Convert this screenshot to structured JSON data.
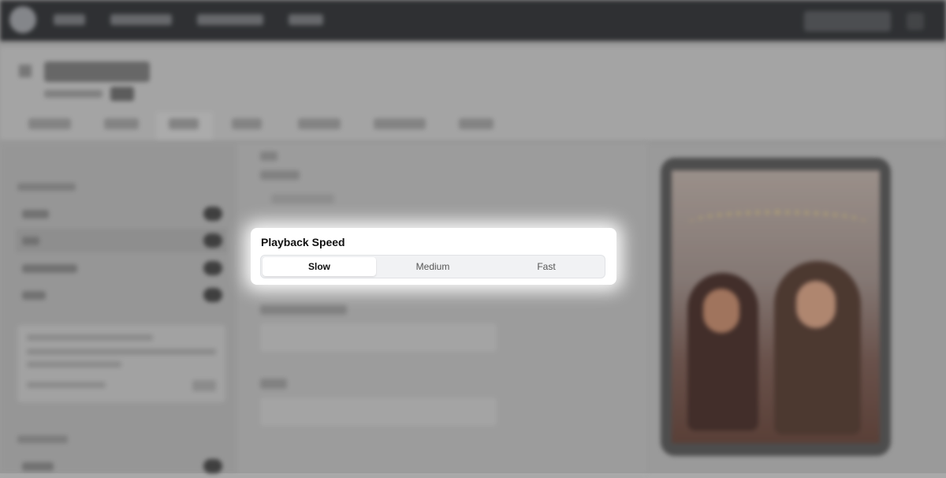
{
  "playback_speed": {
    "title": "Playback Speed",
    "options": [
      "Slow",
      "Medium",
      "Fast"
    ],
    "selected": "Slow"
  }
}
